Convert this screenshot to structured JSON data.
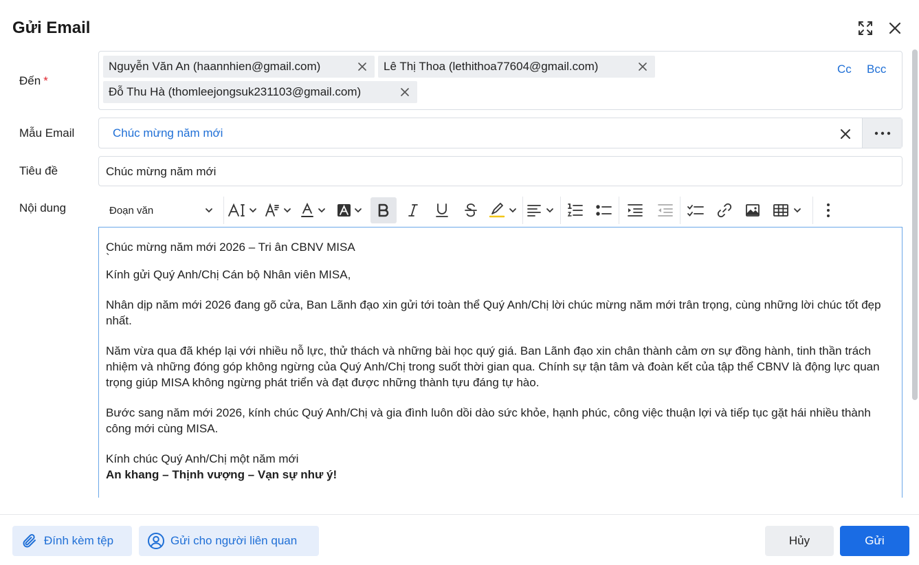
{
  "dialog": {
    "title": "Gửi Email"
  },
  "labels": {
    "to": "Đến",
    "required_mark": "*",
    "template": "Mẫu Email",
    "subject": "Tiêu đề",
    "content": "Nội dung"
  },
  "recipients": [
    "Nguyễn Văn An (haannhien@gmail.com)",
    "Lê Thị Thoa (lethithoa77604@gmail.com)",
    "Đỗ Thu Hà (thomleejongsuk231103@gmail.com)"
  ],
  "cc_label": "Cc",
  "bcc_label": "Bcc",
  "template": {
    "value": "Chúc mừng năm mới"
  },
  "subject": {
    "value": "Chúc mừng năm mới"
  },
  "toolbar": {
    "paragraph_style": "Đoạn văn"
  },
  "body": {
    "heading": "Chúc mừng năm mới 2026 – Tri ân CBNV MISA",
    "tick": "`",
    "greeting": "Kính gửi Quý Anh/Chị Cán bộ Nhân viên MISA,",
    "para1": "Nhân dịp năm mới 2026 đang gõ cửa, Ban Lãnh đạo xin gửi tới toàn thể Quý Anh/Chị lời chúc mừng năm mới trân trọng, cùng những lời chúc tốt đẹp nhất.",
    "para2": "Năm vừa qua đã khép lại với nhiều nỗ lực, thử thách và những bài học quý giá. Ban Lãnh đạo xin chân thành cảm ơn sự đồng hành, tinh thần trách nhiệm và những đóng góp không ngừng của Quý Anh/Chị trong suốt thời gian qua. Chính sự tận tâm và đoàn kết của tập thể CBNV là động lực quan trọng giúp MISA không ngừng phát triển và đạt được những thành tựu đáng tự hào.",
    "para3": "Bước sang năm mới 2026, kính chúc Quý Anh/Chị và gia đình luôn dồi dào sức khỏe, hạnh phúc, công việc thuận lợi và tiếp tục gặt hái nhiều thành công mới cùng MISA.",
    "closing": "Kính chúc Quý Anh/Chị một năm mới",
    "closing_bold": "An khang – Thịnh vượng – Vạn sự như ý!"
  },
  "footer": {
    "attach": "Đính kèm tệp",
    "send_related": "Gửi cho người liên quan",
    "cancel": "Hủy",
    "send": "Gửi"
  },
  "colors": {
    "accent": "#1a6ce4",
    "link": "#1f6fd6",
    "required": "#e0262f"
  }
}
